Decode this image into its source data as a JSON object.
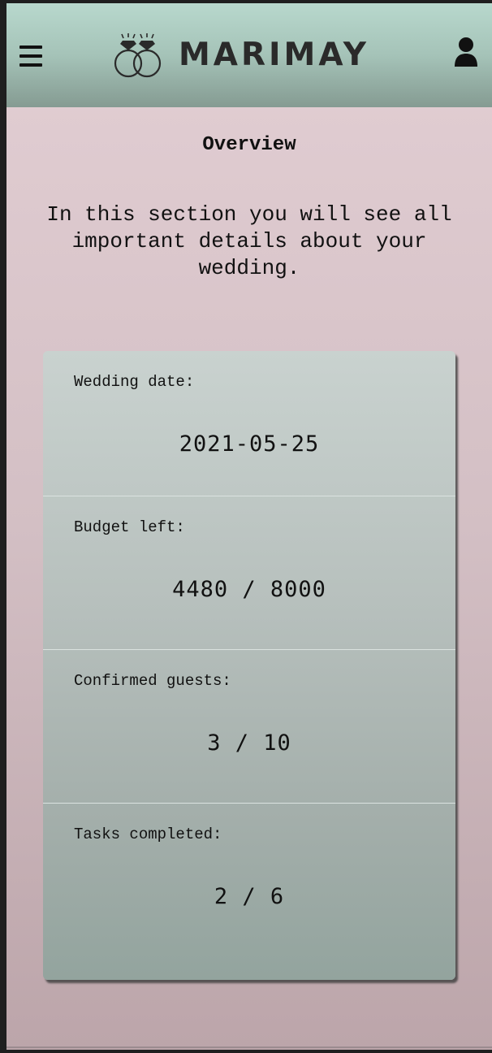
{
  "header": {
    "logo_text": "MARIMAY",
    "menu_icon": "hamburger-menu-icon",
    "user_icon": "user-icon",
    "logo_icon": "wedding-rings-icon"
  },
  "overview": {
    "title": "Overview",
    "intro": "In this section you will see all important details about your wedding."
  },
  "cards": [
    {
      "label": "Wedding date:",
      "value": "2021-05-25"
    },
    {
      "label": "Budget left:",
      "value": "4480 / 8000"
    },
    {
      "label": "Confirmed guests:",
      "value": "3 / 10"
    },
    {
      "label": "Tasks completed:",
      "value": "2 / 6"
    }
  ],
  "colors": {
    "header_top": "#b8d8cd",
    "header_bottom": "#859b92",
    "page_top": "#e3cfd4",
    "page_bottom": "#bca5aa",
    "card_top": "#c9d2cf",
    "card_bottom": "#93a49e"
  }
}
